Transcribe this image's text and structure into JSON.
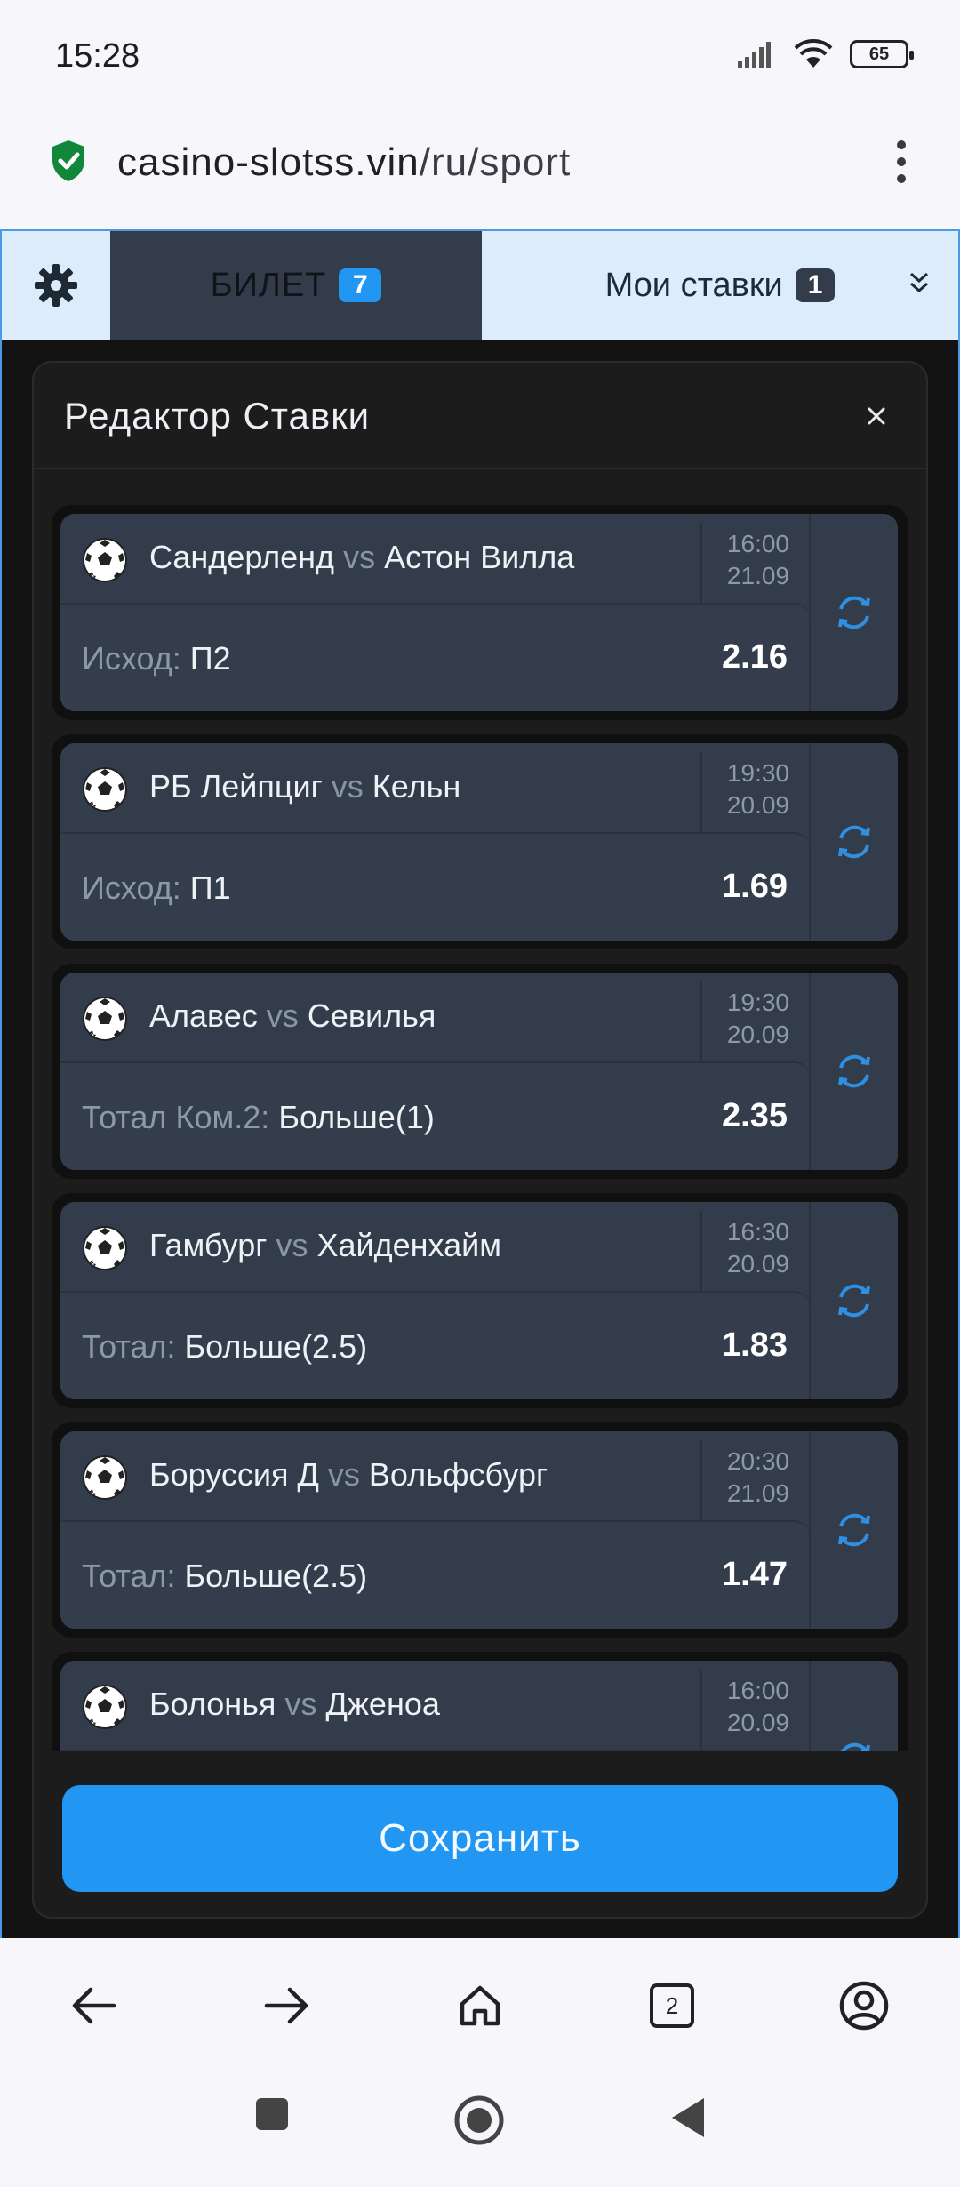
{
  "status_bar": {
    "time": "15:28",
    "battery": "65",
    "icons": [
      "signal-icon",
      "wifi-icon",
      "battery-icon"
    ]
  },
  "browser": {
    "url_host": "casino-slotss.vin",
    "url_path": "/ru/sport",
    "tab_count": "2",
    "icons": [
      "back-icon",
      "forward-icon",
      "home-icon",
      "tabs-icon",
      "account-icon",
      "menu-icon"
    ]
  },
  "app": {
    "nav": {
      "ticket_label": "БИЛЕТ",
      "ticket_count": "7",
      "mybets_label": "Мои ставки",
      "mybets_count": "1"
    },
    "modal": {
      "title": "Редактор Ставки",
      "save_label": "Сохранить"
    },
    "bets": [
      {
        "home": "Сандерленд",
        "vs": "vs",
        "away": "Астон Вилла",
        "time": "16:00",
        "date": "21.09",
        "market": "Исход:",
        "selection": "П2",
        "odds": "2.16"
      },
      {
        "home": "РБ Лейпциг",
        "vs": "vs",
        "away": "Кельн",
        "time": "19:30",
        "date": "20.09",
        "market": "Исход:",
        "selection": "П1",
        "odds": "1.69"
      },
      {
        "home": "Алавес",
        "vs": "vs",
        "away": "Севилья",
        "time": "19:30",
        "date": "20.09",
        "market": "Тотал Ком.2:",
        "selection": "Больше(1)",
        "odds": "2.35"
      },
      {
        "home": "Гамбург",
        "vs": "vs",
        "away": "Хайденхайм",
        "time": "16:30",
        "date": "20.09",
        "market": "Тотал:",
        "selection": "Больше(2.5)",
        "odds": "1.83"
      },
      {
        "home": "Боруссия Д",
        "vs": "vs",
        "away": "Вольфсбург",
        "time": "20:30",
        "date": "21.09",
        "market": "Тотал:",
        "selection": "Больше(2.5)",
        "odds": "1.47"
      },
      {
        "home": "Болонья",
        "vs": "vs",
        "away": "Дженоа",
        "time": "16:00",
        "date": "20.09",
        "market": "",
        "selection": "",
        "odds": ""
      }
    ]
  },
  "colors": {
    "accent": "#2196f3",
    "card": "#333c4a",
    "modal_bg": "#1c1c1c",
    "nav_bg": "#dcecfb"
  }
}
